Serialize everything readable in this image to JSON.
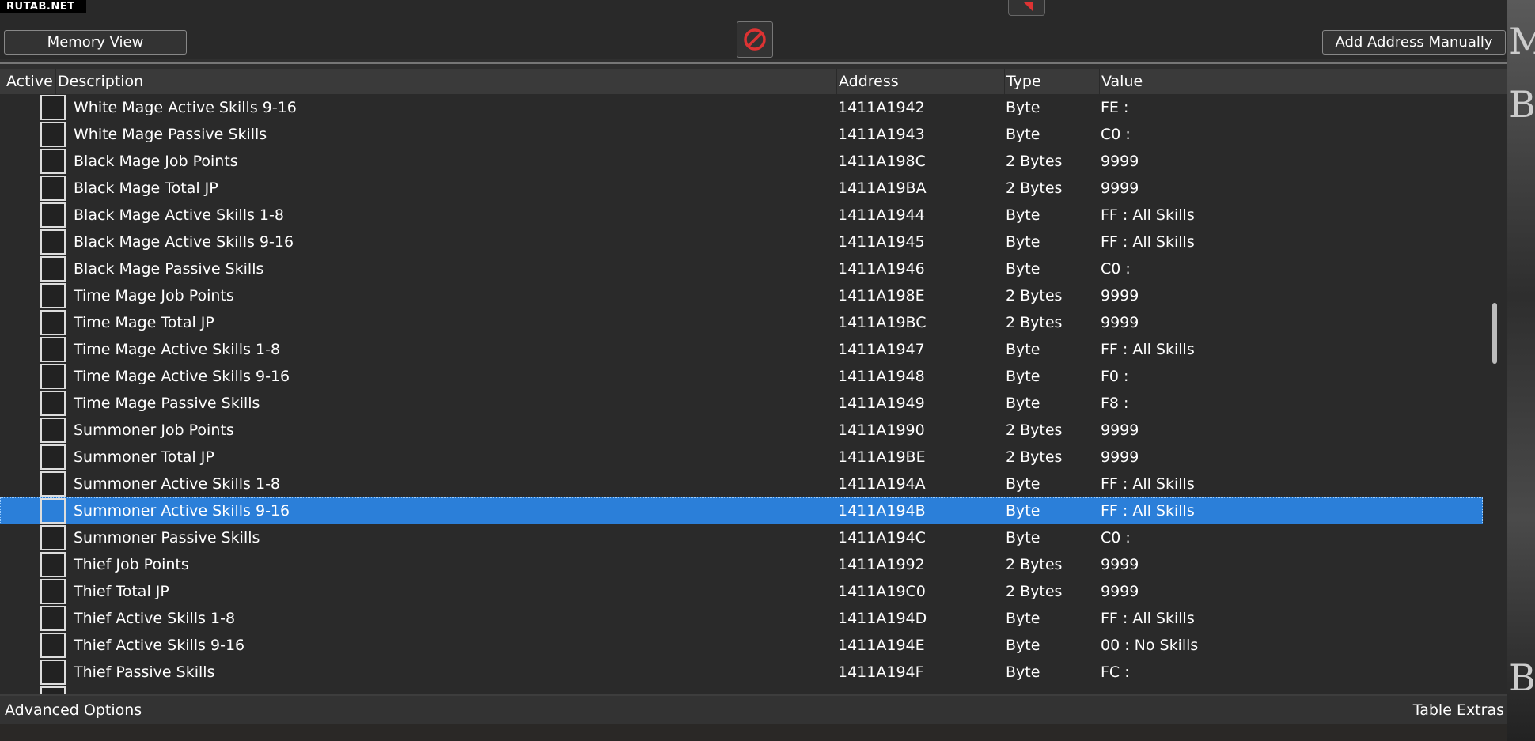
{
  "watermark": "RUTAB.NET",
  "toolbar": {
    "memory_view": "Memory View",
    "add_address": "Add Address Manually"
  },
  "header": {
    "active": "Active",
    "description": "Description",
    "address": "Address",
    "type": "Type",
    "value": "Value"
  },
  "rows": [
    {
      "d": "White Mage Active Skills 9-16",
      "a": "1411A1942",
      "t": "Byte",
      "v": "FE :"
    },
    {
      "d": "White Mage Passive Skills",
      "a": "1411A1943",
      "t": "Byte",
      "v": "C0 :"
    },
    {
      "d": "Black Mage Job Points",
      "a": "1411A198C",
      "t": "2 Bytes",
      "v": "9999"
    },
    {
      "d": "Black Mage Total JP",
      "a": "1411A19BA",
      "t": "2 Bytes",
      "v": "9999"
    },
    {
      "d": "Black Mage Active Skills 1-8",
      "a": "1411A1944",
      "t": "Byte",
      "v": "FF : All Skills"
    },
    {
      "d": "Black Mage Active Skills 9-16",
      "a": "1411A1945",
      "t": "Byte",
      "v": "FF : All Skills"
    },
    {
      "d": "Black Mage Passive Skills",
      "a": "1411A1946",
      "t": "Byte",
      "v": "C0 :"
    },
    {
      "d": "Time Mage Job Points",
      "a": "1411A198E",
      "t": "2 Bytes",
      "v": "9999"
    },
    {
      "d": "Time Mage Total JP",
      "a": "1411A19BC",
      "t": "2 Bytes",
      "v": "9999"
    },
    {
      "d": "Time Mage Active Skills 1-8",
      "a": "1411A1947",
      "t": "Byte",
      "v": "FF : All Skills"
    },
    {
      "d": "Time Mage Active Skills 9-16",
      "a": "1411A1948",
      "t": "Byte",
      "v": "F0 :"
    },
    {
      "d": "Time Mage Passive Skills",
      "a": "1411A1949",
      "t": "Byte",
      "v": "F8 :"
    },
    {
      "d": "Summoner Job Points",
      "a": "1411A1990",
      "t": "2 Bytes",
      "v": "9999"
    },
    {
      "d": "Summoner Total JP",
      "a": "1411A19BE",
      "t": "2 Bytes",
      "v": "9999"
    },
    {
      "d": "Summoner Active Skills 1-8",
      "a": "1411A194A",
      "t": "Byte",
      "v": "FF : All Skills"
    },
    {
      "d": "Summoner Active Skills 9-16",
      "a": "1411A194B",
      "t": "Byte",
      "v": "FF : All Skills",
      "selected": true
    },
    {
      "d": "Summoner Passive Skills",
      "a": "1411A194C",
      "t": "Byte",
      "v": "C0 :"
    },
    {
      "d": "Thief Job Points",
      "a": "1411A1992",
      "t": "2 Bytes",
      "v": "9999"
    },
    {
      "d": "Thief Total JP",
      "a": "1411A19C0",
      "t": "2 Bytes",
      "v": "9999"
    },
    {
      "d": "Thief Active Skills 1-8",
      "a": "1411A194D",
      "t": "Byte",
      "v": "FF : All Skills"
    },
    {
      "d": "Thief Active Skills 9-16",
      "a": "1411A194E",
      "t": "Byte",
      "v": "00 : No Skills"
    },
    {
      "d": "Thief Passive Skills",
      "a": "1411A194F",
      "t": "Byte",
      "v": "FC :"
    }
  ],
  "footer": {
    "advanced": "Advanced Options",
    "extras": "Table Extras"
  },
  "colors": {
    "selection": "#2b7fd9",
    "stop_icon": "#d33"
  }
}
